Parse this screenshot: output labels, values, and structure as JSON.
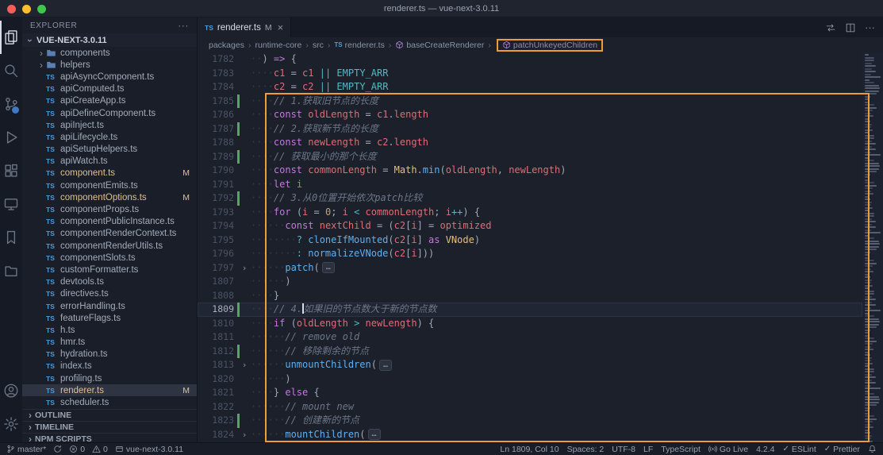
{
  "window": {
    "title": "renderer.ts — vue-next-3.0.11"
  },
  "activity_bar": {
    "top": [
      {
        "id": "explorer",
        "active": true
      },
      {
        "id": "search"
      },
      {
        "id": "source-control",
        "badge": true
      },
      {
        "id": "run-debug"
      },
      {
        "id": "extensions"
      },
      {
        "id": "live-server"
      },
      {
        "id": "bookmarks"
      },
      {
        "id": "project-manager"
      }
    ],
    "bottom": [
      {
        "id": "account"
      },
      {
        "id": "settings"
      }
    ]
  },
  "sidebar": {
    "title": "EXPLORER",
    "more": "···",
    "root": "VUE-NEXT-3.0.11",
    "tree": [
      {
        "label": "components",
        "kind": "folder"
      },
      {
        "label": "helpers",
        "kind": "folder"
      },
      {
        "label": "apiAsyncComponent.ts",
        "kind": "ts"
      },
      {
        "label": "apiComputed.ts",
        "kind": "ts"
      },
      {
        "label": "apiCreateApp.ts",
        "kind": "ts"
      },
      {
        "label": "apiDefineComponent.ts",
        "kind": "ts"
      },
      {
        "label": "apiInject.ts",
        "kind": "ts"
      },
      {
        "label": "apiLifecycle.ts",
        "kind": "ts"
      },
      {
        "label": "apiSetupHelpers.ts",
        "kind": "ts"
      },
      {
        "label": "apiWatch.ts",
        "kind": "ts"
      },
      {
        "label": "component.ts",
        "kind": "ts",
        "badge": "M"
      },
      {
        "label": "componentEmits.ts",
        "kind": "ts"
      },
      {
        "label": "componentOptions.ts",
        "kind": "ts",
        "badge": "M"
      },
      {
        "label": "componentProps.ts",
        "kind": "ts"
      },
      {
        "label": "componentPublicInstance.ts",
        "kind": "ts"
      },
      {
        "label": "componentRenderContext.ts",
        "kind": "ts"
      },
      {
        "label": "componentRenderUtils.ts",
        "kind": "ts"
      },
      {
        "label": "componentSlots.ts",
        "kind": "ts"
      },
      {
        "label": "customFormatter.ts",
        "kind": "ts"
      },
      {
        "label": "devtools.ts",
        "kind": "ts"
      },
      {
        "label": "directives.ts",
        "kind": "ts"
      },
      {
        "label": "errorHandling.ts",
        "kind": "ts"
      },
      {
        "label": "featureFlags.ts",
        "kind": "ts"
      },
      {
        "label": "h.ts",
        "kind": "ts"
      },
      {
        "label": "hmr.ts",
        "kind": "ts"
      },
      {
        "label": "hydration.ts",
        "kind": "ts"
      },
      {
        "label": "index.ts",
        "kind": "ts"
      },
      {
        "label": "profiling.ts",
        "kind": "ts"
      },
      {
        "label": "renderer.ts",
        "kind": "ts",
        "badge": "M",
        "selected": true
      },
      {
        "label": "scheduler.ts",
        "kind": "ts"
      }
    ],
    "bottom_sections": [
      "OUTLINE",
      "TIMELINE",
      "NPM SCRIPTS"
    ]
  },
  "tab_bar": {
    "tab": {
      "icon_label": "TS",
      "label": "renderer.ts",
      "git_badge": "M",
      "close": "×"
    },
    "actions": [
      {
        "id": "open-changes"
      },
      {
        "id": "split-editor"
      },
      {
        "id": "more-actions",
        "glyph": "···"
      }
    ]
  },
  "breadcrumbs": [
    {
      "label": "packages"
    },
    {
      "label": "runtime-core"
    },
    {
      "label": "src"
    },
    {
      "label": "renderer.ts",
      "icon": "ts"
    },
    {
      "label": "baseCreateRenderer",
      "icon": "method"
    },
    {
      "label": "patchUnkeyedChildren",
      "icon": "method",
      "highlighted": true
    }
  ],
  "editor": {
    "lines": [
      {
        "n": 1782,
        "t": [
          [
            "··",
            "w"
          ],
          [
            ") ",
            "p"
          ],
          [
            "=>",
            "k"
          ],
          [
            " {",
            "p"
          ]
        ]
      },
      {
        "n": 1783,
        "t": [
          [
            "····",
            "w"
          ],
          [
            "c1 ",
            "v"
          ],
          [
            "= ",
            "p"
          ],
          [
            "c1 ",
            "v"
          ],
          [
            "|| ",
            "o"
          ],
          [
            "EMPTY_ARR",
            "d"
          ]
        ]
      },
      {
        "n": 1784,
        "t": [
          [
            "····",
            "w"
          ],
          [
            "c2 ",
            "v"
          ],
          [
            "= ",
            "p"
          ],
          [
            "c2 ",
            "v"
          ],
          [
            "|| ",
            "o"
          ],
          [
            "EMPTY_ARR",
            "d"
          ]
        ]
      },
      {
        "n": 1785,
        "git": 1,
        "t": [
          [
            "····",
            "w"
          ],
          [
            "// 1.获取旧节点的长度",
            "c"
          ]
        ]
      },
      {
        "n": 1786,
        "t": [
          [
            "····",
            "w"
          ],
          [
            "const ",
            "k"
          ],
          [
            "oldLength ",
            "v"
          ],
          [
            "= ",
            "p"
          ],
          [
            "c1",
            "v"
          ],
          [
            ".",
            "p"
          ],
          [
            "length",
            "v"
          ]
        ]
      },
      {
        "n": 1787,
        "git": 1,
        "t": [
          [
            "····",
            "w"
          ],
          [
            "// 2.获取新节点的长度",
            "c"
          ]
        ]
      },
      {
        "n": 1788,
        "t": [
          [
            "····",
            "w"
          ],
          [
            "const ",
            "k"
          ],
          [
            "newLength ",
            "v"
          ],
          [
            "= ",
            "p"
          ],
          [
            "c2",
            "v"
          ],
          [
            ".",
            "p"
          ],
          [
            "length",
            "v"
          ]
        ]
      },
      {
        "n": 1789,
        "git": 1,
        "t": [
          [
            "····",
            "w"
          ],
          [
            "// 获取最小的那个长度",
            "c"
          ]
        ]
      },
      {
        "n": 1790,
        "t": [
          [
            "····",
            "w"
          ],
          [
            "const ",
            "k"
          ],
          [
            "commonLength ",
            "v"
          ],
          [
            "= ",
            "p"
          ],
          [
            "Math",
            "t"
          ],
          [
            ".",
            "p"
          ],
          [
            "min",
            "f"
          ],
          [
            "(",
            "p"
          ],
          [
            "oldLength",
            "v"
          ],
          [
            ", ",
            "p"
          ],
          [
            "newLength",
            "v"
          ],
          [
            ")",
            "p"
          ]
        ]
      },
      {
        "n": 1791,
        "t": [
          [
            "····",
            "w"
          ],
          [
            "let ",
            "k"
          ],
          [
            "i",
            "v"
          ]
        ]
      },
      {
        "n": 1792,
        "git": 1,
        "t": [
          [
            "····",
            "w"
          ],
          [
            "// 3.从0位置开始依次patch比较",
            "c"
          ]
        ]
      },
      {
        "n": 1793,
        "t": [
          [
            "····",
            "w"
          ],
          [
            "for ",
            "k"
          ],
          [
            "(",
            "p"
          ],
          [
            "i ",
            "v"
          ],
          [
            "= ",
            "p"
          ],
          [
            "0",
            "n"
          ],
          [
            "; ",
            "p"
          ],
          [
            "i ",
            "v"
          ],
          [
            "< ",
            "o"
          ],
          [
            "commonLength",
            "v"
          ],
          [
            "; ",
            "p"
          ],
          [
            "i",
            "v"
          ],
          [
            "++",
            "o"
          ],
          [
            ") {",
            "p"
          ]
        ]
      },
      {
        "n": 1794,
        "t": [
          [
            "······",
            "w"
          ],
          [
            "const ",
            "k"
          ],
          [
            "nextChild ",
            "v"
          ],
          [
            "= ",
            "p"
          ],
          [
            "(",
            "p"
          ],
          [
            "c2",
            "v"
          ],
          [
            "[",
            "p"
          ],
          [
            "i",
            "v"
          ],
          [
            "] ",
            "p"
          ],
          [
            "= ",
            "p"
          ],
          [
            "optimized",
            "v"
          ]
        ]
      },
      {
        "n": 1795,
        "t": [
          [
            "········",
            "w"
          ],
          [
            "? ",
            "o"
          ],
          [
            "cloneIfMounted",
            "f"
          ],
          [
            "(",
            "p"
          ],
          [
            "c2",
            "v"
          ],
          [
            "[",
            "p"
          ],
          [
            "i",
            "v"
          ],
          [
            "]",
            "p"
          ],
          [
            " as ",
            "k"
          ],
          [
            "VNode",
            "t"
          ],
          [
            ")",
            "p"
          ]
        ]
      },
      {
        "n": 1796,
        "t": [
          [
            "········",
            "w"
          ],
          [
            ": ",
            "o"
          ],
          [
            "normalizeVNode",
            "f"
          ],
          [
            "(",
            "p"
          ],
          [
            "c2",
            "v"
          ],
          [
            "[",
            "p"
          ],
          [
            "i",
            "v"
          ],
          [
            "]",
            "p"
          ],
          [
            "))",
            "p"
          ]
        ]
      },
      {
        "n": 1797,
        "fold": 1,
        "t": [
          [
            "······",
            "w"
          ],
          [
            "patch",
            "f"
          ],
          [
            "(",
            "p"
          ],
          [
            "…",
            "x"
          ]
        ]
      },
      {
        "n": 1807,
        "t": [
          [
            "······",
            "w"
          ],
          [
            ")",
            "p"
          ]
        ]
      },
      {
        "n": 1808,
        "t": [
          [
            "····",
            "w"
          ],
          [
            "}",
            "p"
          ]
        ]
      },
      {
        "n": 1809,
        "git": 1,
        "active": 1,
        "t": [
          [
            "····",
            "w"
          ],
          [
            "// 4.",
            "c"
          ],
          [
            "|",
            "cur"
          ],
          [
            "如果旧的节点数大于新的节点数",
            "c"
          ]
        ]
      },
      {
        "n": 1810,
        "t": [
          [
            "····",
            "w"
          ],
          [
            "if ",
            "k"
          ],
          [
            "(",
            "p"
          ],
          [
            "oldLength ",
            "v"
          ],
          [
            "> ",
            "o"
          ],
          [
            "newLength",
            "v"
          ],
          [
            ") {",
            "p"
          ]
        ]
      },
      {
        "n": 1811,
        "t": [
          [
            "······",
            "w"
          ],
          [
            "// remove old",
            "c"
          ]
        ]
      },
      {
        "n": 1812,
        "git": 1,
        "t": [
          [
            "······",
            "w"
          ],
          [
            "// 移除剩余的节点",
            "c"
          ]
        ]
      },
      {
        "n": 1813,
        "fold": 1,
        "t": [
          [
            "······",
            "w"
          ],
          [
            "unmountChildren",
            "f"
          ],
          [
            "(",
            "p"
          ],
          [
            "…",
            "x"
          ]
        ]
      },
      {
        "n": 1820,
        "t": [
          [
            "······",
            "w"
          ],
          [
            ")",
            "p"
          ]
        ]
      },
      {
        "n": 1821,
        "t": [
          [
            "····",
            "w"
          ],
          [
            "} ",
            "p"
          ],
          [
            "else",
            "k"
          ],
          [
            " {",
            "p"
          ]
        ]
      },
      {
        "n": 1822,
        "t": [
          [
            "······",
            "w"
          ],
          [
            "// mount new",
            "c"
          ]
        ]
      },
      {
        "n": 1823,
        "git": 1,
        "t": [
          [
            "······",
            "w"
          ],
          [
            "// 创建新的节点",
            "c"
          ]
        ]
      },
      {
        "n": 1824,
        "fold": 1,
        "t": [
          [
            "······",
            "w"
          ],
          [
            "mountChildren",
            "f"
          ],
          [
            "(",
            "p"
          ],
          [
            "…",
            "x"
          ]
        ]
      }
    ]
  },
  "status_bar": {
    "left": [
      {
        "id": "branch",
        "icon": "branch",
        "label": "master*"
      },
      {
        "id": "sync",
        "icon": "sync",
        "label": ""
      },
      {
        "id": "errors",
        "icon": "error",
        "label": "0"
      },
      {
        "id": "warnings",
        "icon": "warning",
        "label": "0"
      },
      {
        "id": "project",
        "icon": "project",
        "label": "vue-next-3.0.11"
      }
    ],
    "right": [
      {
        "id": "line-col",
        "label": "Ln 1809, Col 10"
      },
      {
        "id": "indentation",
        "label": "Spaces: 2"
      },
      {
        "id": "encoding",
        "label": "UTF-8"
      },
      {
        "id": "eol",
        "label": "LF"
      },
      {
        "id": "language",
        "label": "TypeScript"
      },
      {
        "id": "go-live",
        "icon": "broadcast",
        "label": "Go Live"
      },
      {
        "id": "ts-version",
        "label": "4.2.4"
      },
      {
        "id": "eslint",
        "icon": "check",
        "label": "ESLint"
      },
      {
        "id": "prettier",
        "icon": "check",
        "label": "Prettier"
      },
      {
        "id": "notifications",
        "icon": "bell",
        "label": ""
      }
    ]
  },
  "colors": {
    "annotation": "#f09c34",
    "git_modified": "#e2c08d",
    "git_added_gutter": "#52a85f",
    "ts_icon_blue": "#4f9cd6",
    "badge_blue": "#3f78c3"
  }
}
